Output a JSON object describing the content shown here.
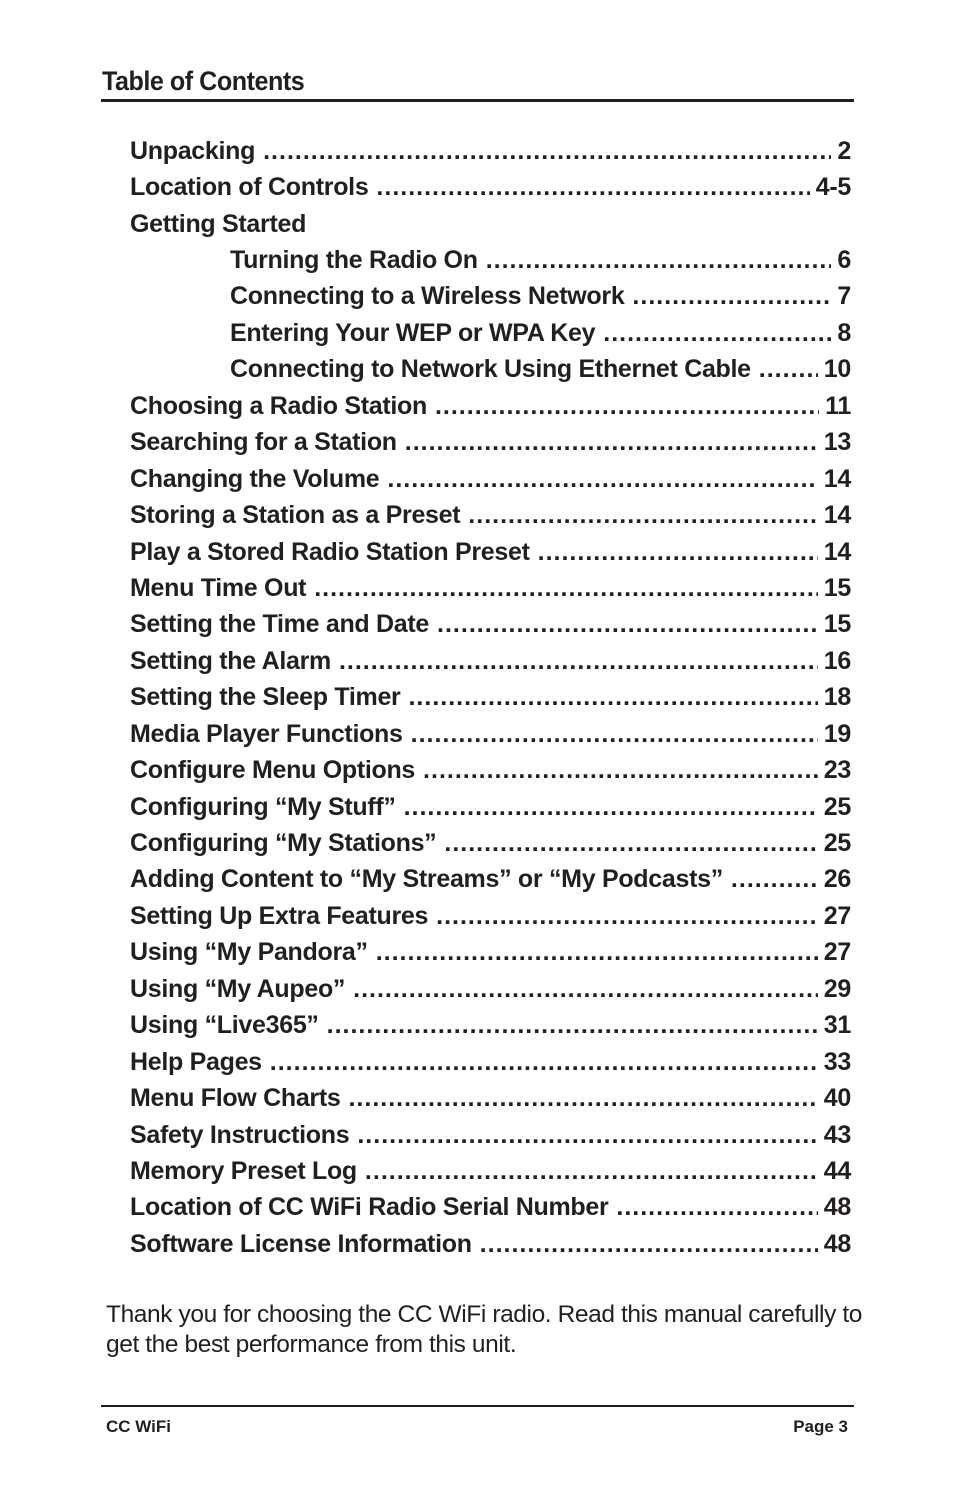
{
  "header": {
    "title": "Table of Contents"
  },
  "toc": [
    {
      "label": "Unpacking",
      "page": "2",
      "level": 1
    },
    {
      "label": "Location of Controls",
      "page": "4-5",
      "level": 1
    },
    {
      "label": "Getting Started",
      "page": "",
      "level": 1,
      "heading": true
    },
    {
      "label": "Turning the Radio On",
      "page": "6",
      "level": 2
    },
    {
      "label": "Connecting to a Wireless Network",
      "page": "7",
      "level": 2
    },
    {
      "label": "Entering Your WEP or WPA Key",
      "page": "8",
      "level": 2
    },
    {
      "label": "Connecting to Network Using Ethernet Cable",
      "page": "10",
      "level": 2
    },
    {
      "label": "Choosing a Radio Station",
      "page": "11",
      "level": 1
    },
    {
      "label": "Searching for a Station",
      "page": "13",
      "level": 1
    },
    {
      "label": "Changing the Volume",
      "page": "14",
      "level": 1
    },
    {
      "label": "Storing a Station as a Preset",
      "page": "14",
      "level": 1
    },
    {
      "label": "Play a Stored Radio Station Preset",
      "page": "14",
      "level": 1
    },
    {
      "label": "Menu Time Out",
      "page": "15",
      "level": 1
    },
    {
      "label": "Setting the Time and Date",
      "page": "15",
      "level": 1
    },
    {
      "label": "Setting the Alarm",
      "page": "16",
      "level": 1
    },
    {
      "label": "Setting the Sleep Timer",
      "page": "18",
      "level": 1
    },
    {
      "label": "Media Player Functions",
      "page": "19",
      "level": 1
    },
    {
      "label": "Configure Menu Options",
      "page": "23",
      "level": 1
    },
    {
      "label": "Configuring “My Stuff”",
      "page": "25",
      "level": 1
    },
    {
      "label": "Configuring “My Stations”",
      "page": "25",
      "level": 1
    },
    {
      "label": "Adding Content to “My Streams” or “My Podcasts”",
      "page": "26",
      "level": 1
    },
    {
      "label": "Setting Up Extra Features",
      "page": "27",
      "level": 1
    },
    {
      "label": "Using “My Pandora”",
      "page": "27",
      "level": 1
    },
    {
      "label": "Using “My Aupeo”",
      "page": "29",
      "level": 1
    },
    {
      "label": "Using “Live365”",
      "page": "31",
      "level": 1
    },
    {
      "label": "Help Pages",
      "page": "33",
      "level": 1
    },
    {
      "label": "Menu Flow Charts",
      "page": "40",
      "level": 1
    },
    {
      "label": "Safety Instructions",
      "page": "43",
      "level": 1
    },
    {
      "label": "Memory Preset Log",
      "page": "44",
      "level": 1
    },
    {
      "label": "Location of CC WiFi Radio Serial Number",
      "page": "48",
      "level": 1
    },
    {
      "label": "Software License Information",
      "page": "48",
      "level": 1
    }
  ],
  "intro": "Thank you for choosing the CC WiFi radio. Read this manual carefully to get the best performance from this unit.",
  "footer": {
    "product": "CC WiFi",
    "page_label": "Page 3"
  }
}
